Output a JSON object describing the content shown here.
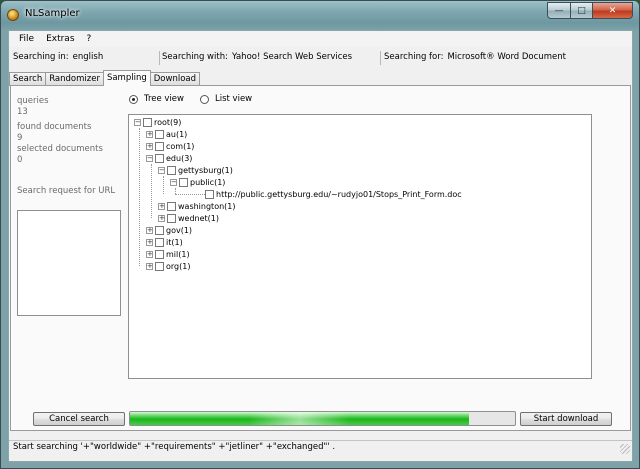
{
  "window": {
    "title": "NLSampler"
  },
  "menu": [
    "File",
    "Extras",
    "?"
  ],
  "info": {
    "searching_in_label": "Searching in:",
    "searching_in_value": "english",
    "searching_with_label": "Searching with:",
    "searching_with_value": "Yahoo! Search Web Services",
    "searching_for_label": "Searching for:",
    "searching_for_value": "Microsoft® Word Document"
  },
  "tabs": [
    "Search",
    "Randomizer",
    "Sampling",
    "Download"
  ],
  "active_tab": "Sampling",
  "stats": {
    "queries_label": "queries",
    "queries_value": "13",
    "found_label": "found documents",
    "found_value": "9",
    "selected_label": "selected documents",
    "selected_value": "0",
    "url_label": "Search request for URL"
  },
  "view": {
    "tree_label": "Tree view",
    "list_label": "List view",
    "selected": "tree"
  },
  "tree": [
    {
      "label": "root(9)",
      "expanded": true
    },
    {
      "label": "au(1)",
      "expanded": false
    },
    {
      "label": "com(1)",
      "expanded": false
    },
    {
      "label": "edu(3)",
      "expanded": true
    },
    {
      "label": "gettysburg(1)",
      "expanded": true
    },
    {
      "label": "public(1)",
      "expanded": true
    },
    {
      "label": "http://public.gettysburg.edu/~rudyjo01/Stops_Print_Form.doc"
    },
    {
      "label": "washington(1)",
      "expanded": false
    },
    {
      "label": "wednet(1)",
      "expanded": false
    },
    {
      "label": "gov(1)",
      "expanded": false
    },
    {
      "label": "it(1)",
      "expanded": false
    },
    {
      "label": "mil(1)",
      "expanded": false
    },
    {
      "label": "org(1)",
      "expanded": false
    }
  ],
  "buttons": {
    "cancel": "Cancel search",
    "download": "Start download"
  },
  "progress": {
    "percent": 88
  },
  "status": "Start searching '+\"worldwide\" +\"requirements\" +\"jetliner\" +\"exchanged\"' ."
}
